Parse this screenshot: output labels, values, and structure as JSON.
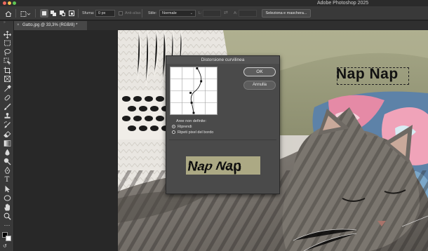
{
  "app": {
    "title": "Adobe Photoshop 2025"
  },
  "options_bar": {
    "feather_label": "Sfuma:",
    "feather_value": "0 px",
    "antialias_label": "Anti-alias",
    "style_label": "Stile:",
    "style_value": "Normale",
    "width_label": "L:",
    "height_label": "A:",
    "select_mask_label": "Seleziona e maschera..."
  },
  "document_tab": {
    "close_glyph": "×",
    "name": "Gatto.jpg @ 33,3% (RGB/8) *"
  },
  "canvas_text": {
    "text": "Nap Nap"
  },
  "dialog": {
    "title": "Distorsione curvilinea",
    "ok_label": "OK",
    "cancel_label": "Annulla",
    "undefined_areas_label": "Aree non definite:",
    "options": [
      {
        "label": "Riprendi",
        "selected": true
      },
      {
        "label": "Ripeti pixel del bordo",
        "selected": false
      }
    ],
    "preview_text": "Nap Nap"
  },
  "colors": {
    "accent_ok_border": "#d0d0d0",
    "dialog_bg": "#4a4a4a",
    "preview_bg": "#aca984"
  },
  "toolbar_tools": [
    "move-tool",
    "marquee-tool",
    "lasso-tool",
    "object-select-tool",
    "crop-tool",
    "frame-tool",
    "eyedropper-tool",
    "healing-brush-tool",
    "brush-tool",
    "clone-stamp-tool",
    "history-brush-tool",
    "eraser-tool",
    "gradient-tool",
    "blur-tool",
    "dodge-tool",
    "pen-tool",
    "type-tool",
    "path-select-tool",
    "shape-tool",
    "hand-tool",
    "zoom-tool",
    "more-tools"
  ]
}
